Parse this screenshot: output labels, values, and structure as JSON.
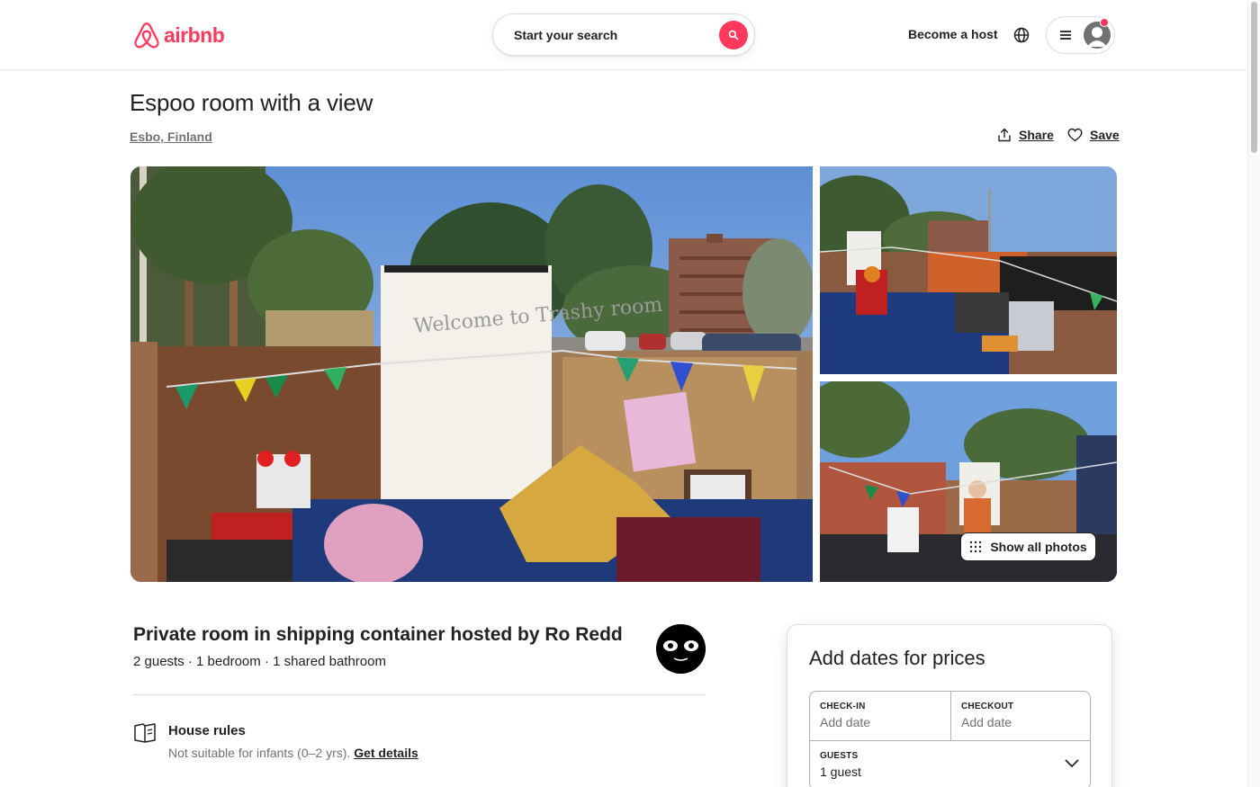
{
  "header": {
    "logo_text": "airbnb",
    "search_label": "Start your search",
    "become_host": "Become a host",
    "brand_color": "#FF385C"
  },
  "listing": {
    "title": "Espoo room with a view",
    "location": "Esbo, Finland",
    "share_label": "Share",
    "save_label": "Save",
    "show_all_photos": "Show all photos",
    "photo_sign_text": "Welcome to Trashy room",
    "type_host": "Private room in shipping container hosted by Ro Redd",
    "details": "2 guests · 1 bedroom · 1 shared bathroom",
    "house_rules": {
      "title": "House rules",
      "text": "Not suitable for infants (0–2 yrs). ",
      "link": "Get details"
    }
  },
  "booking": {
    "title": "Add dates for prices",
    "checkin_label": "CHECK-IN",
    "checkin_value": "Add date",
    "checkout_label": "CHECKOUT",
    "checkout_value": "Add date",
    "guests_label": "GUESTS",
    "guests_value": "1 guest"
  },
  "icons": [
    "airbnb-logo-icon",
    "search-icon",
    "globe-icon",
    "menu-icon",
    "user-avatar-icon",
    "share-icon",
    "heart-icon",
    "grid-dots-icon",
    "rules-book-icon",
    "chevron-down-icon"
  ]
}
